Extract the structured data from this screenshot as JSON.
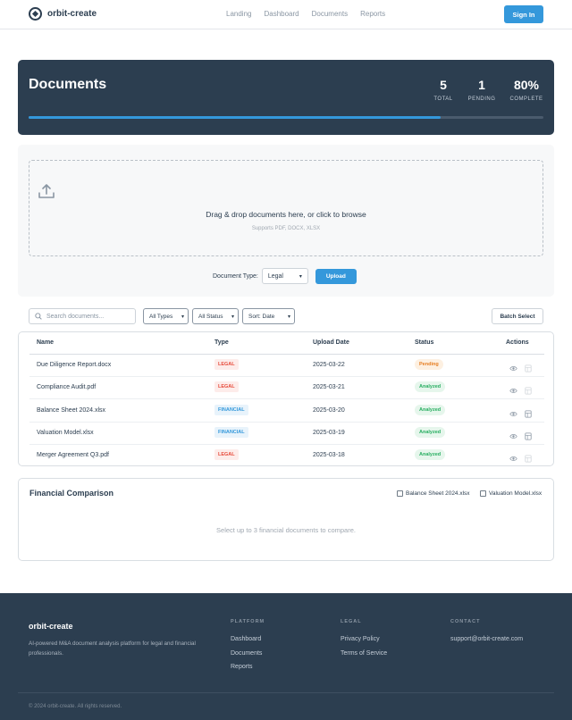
{
  "nav": {
    "brand": "orbit-create",
    "links": [
      "Landing",
      "Dashboard",
      "Documents",
      "Reports"
    ],
    "signin_label": "Sign In"
  },
  "hero": {
    "title": "Documents",
    "stats": [
      {
        "value": "5",
        "label": "TOTAL"
      },
      {
        "value": "1",
        "label": "PENDING"
      },
      {
        "value": "80%",
        "label": "COMPLETE"
      }
    ],
    "progress_fraction": 0.8
  },
  "upload": {
    "drop_text": "Drag & drop documents here, or click to browse",
    "supported": "Supports PDF, DOCX, XLSX",
    "doctype_label": "Document Type:",
    "doctype_value": "Legal",
    "upload_label": "Upload"
  },
  "filters": {
    "search_placeholder": "Search documents...",
    "type_value": "All Types",
    "status_value": "All Status",
    "sort_value": "Sort: Date",
    "batch_label": "Batch Select"
  },
  "table": {
    "headers": [
      "Name",
      "Type",
      "Upload Date",
      "Status",
      "Actions"
    ],
    "rows": [
      {
        "name": "Due Diligence Report.docx",
        "type": "LEGAL",
        "date": "2025-03-22",
        "status": "Pending"
      },
      {
        "name": "Compliance Audit.pdf",
        "type": "LEGAL",
        "date": "2025-03-21",
        "status": "Analyzed"
      },
      {
        "name": "Balance Sheet 2024.xlsx",
        "type": "FINANCIAL",
        "date": "2025-03-20",
        "status": "Analyzed"
      },
      {
        "name": "Valuation Model.xlsx",
        "type": "FINANCIAL",
        "date": "2025-03-19",
        "status": "Analyzed"
      },
      {
        "name": "Merger Agreement Q3.pdf",
        "type": "LEGAL",
        "date": "2025-03-18",
        "status": "Analyzed"
      }
    ]
  },
  "comparison": {
    "title": "Financial Comparison",
    "options": [
      "Balance Sheet 2024.xlsx",
      "Valuation Model.xlsx"
    ],
    "empty": "Select up to 3 financial documents to compare."
  },
  "footer": {
    "brand": "orbit-create",
    "description": "AI-powered M&A document analysis platform for legal and financial professionals.",
    "platform_heading": "PLATFORM",
    "platform_links": [
      "Dashboard",
      "Documents",
      "Reports"
    ],
    "legal_heading": "LEGAL",
    "legal_links": [
      "Privacy Policy",
      "Terms of Service"
    ],
    "contact_heading": "CONTACT",
    "contact_email": "support@orbit-create.com",
    "copyright": "© 2024 orbit-create. All rights reserved."
  },
  "colors": {
    "accent": "#3498db",
    "navy": "#2c3e50",
    "legal_badge": "#e74c3c",
    "financial_badge": "#3498db",
    "pending": "#e67e22",
    "analyzed": "#27ae60"
  }
}
